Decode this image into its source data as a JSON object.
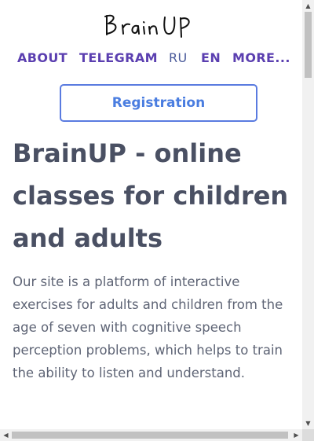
{
  "header": {
    "logo_text": "BrainUP"
  },
  "nav": {
    "items": [
      {
        "label": "ABOUT",
        "active": true
      },
      {
        "label": "TELEGRAM",
        "active": true
      },
      {
        "label": "RU",
        "active": false
      },
      {
        "label": "EN",
        "active": true
      },
      {
        "label": "MORE..."
      }
    ]
  },
  "main": {
    "registration_label": "Registration",
    "title": "BrainUP - online classes for children and adults",
    "description": "Our site is a platform of interactive exercises for adults and children from the age of seven with cognitive speech perception problems, which helps to train the ability to listen and understand."
  },
  "scrollbars": {
    "up_icon": "triangle-up-icon",
    "down_icon": "triangle-down-icon",
    "left_icon": "triangle-left-icon",
    "right_icon": "triangle-right-icon"
  },
  "colors": {
    "nav_accent": "#5b3fb0",
    "button_border": "#5a7be0",
    "heading": "#4a5063",
    "body_text": "#5e6475"
  }
}
